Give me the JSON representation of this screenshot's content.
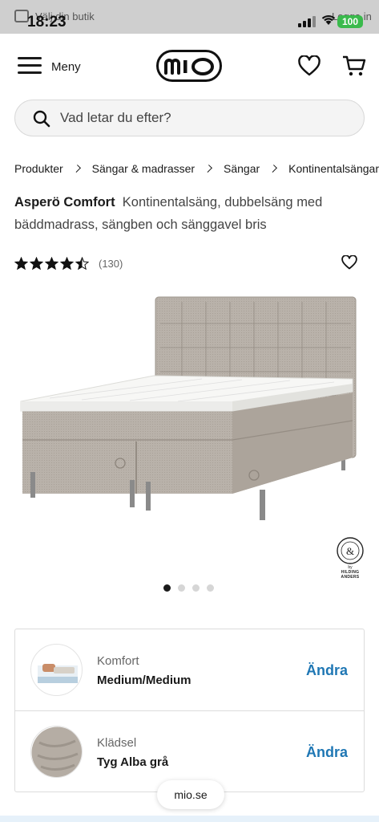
{
  "status_bar": {
    "overlay_text": "Välj din butik",
    "time": "18:23",
    "battery": "100",
    "login": "Logga in"
  },
  "header": {
    "menu_label": "Meny",
    "logo_text": "mio"
  },
  "search": {
    "placeholder": "Vad letar du efter?"
  },
  "breadcrumb": [
    "Produkter",
    "Sängar & madrasser",
    "Sängar",
    "Kontinentalsängar"
  ],
  "product": {
    "name": "Asperö Comfort",
    "description": "Kontinentalsäng, dubbelsäng med bäddmadrass, sängben och sänggavel bris",
    "rating": 4.5,
    "rating_count": "(130)",
    "brand_badge": "HILDING ANDERS",
    "brand_by": "by"
  },
  "carousel": {
    "total": 4,
    "active_index": 0
  },
  "options": [
    {
      "label": "Komfort",
      "value": "Medium/Medium",
      "action": "Ändra"
    },
    {
      "label": "Klädsel",
      "value": "Tyg Alba grå",
      "action": "Ändra"
    }
  ],
  "url_pill": "mio.se",
  "colors": {
    "link": "#1f77b4",
    "fabric": "#b9b2aa",
    "battery": "#3aba4c"
  }
}
